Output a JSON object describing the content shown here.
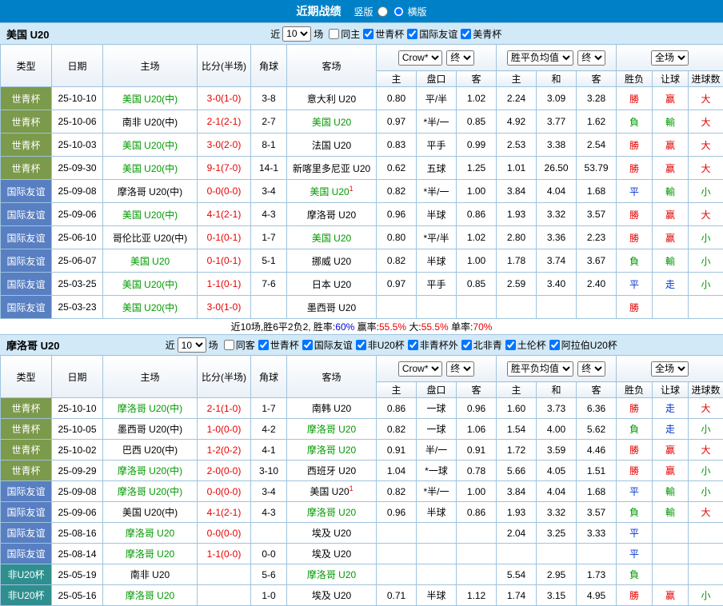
{
  "topbar": {
    "title": "近期战绩",
    "vertical_label": "竖版",
    "horizontal_label": "横版",
    "selected": "横版"
  },
  "colors": {
    "topbar_bg": "#0081C7",
    "section_bg": "#D2E9F7",
    "border": "#9FC3DE",
    "score_red": "#E60000",
    "team_green": "#009900",
    "draw_blue": "#0033CC",
    "league": {
      "世青杯": "#7B9A4B",
      "国际友谊": "#587FC2",
      "非U20杯": "#2E8F8E",
      "美青杯": "#7B9A4B"
    }
  },
  "th": {
    "type": "类型",
    "date": "日期",
    "home": "主场",
    "score": "比分(半场)",
    "corner": "角球",
    "away": "客场",
    "crow": "Crow*",
    "final": "终",
    "avg": "胜平负均值",
    "full": "全场",
    "h": "主",
    "hcp": "盘口",
    "a": "客",
    "h2": "主",
    "d": "和",
    "a2": "客",
    "result": "胜负",
    "handicap": "让球",
    "goals": "进球数"
  },
  "usa": {
    "team": "美国 U20",
    "filter": {
      "prefix": "近",
      "count": "10",
      "suffix": "场",
      "options": [
        {
          "label": "同主",
          "checked": false
        },
        {
          "label": "世青杯",
          "checked": true
        },
        {
          "label": "国际友谊",
          "checked": true
        },
        {
          "label": "美青杯",
          "checked": true
        }
      ]
    },
    "rows": [
      {
        "league": "世青杯",
        "date": "25-10-10",
        "home": "美国 U20(中)",
        "home_self": true,
        "score": "3-0(1-0)",
        "corner": "3-8",
        "away": "意大利 U20",
        "away_self": false,
        "away_sup": "",
        "h": "0.80",
        "hcp": "平/半",
        "a": "1.02",
        "avg_h": "2.24",
        "avg_d": "3.09",
        "avg_a": "3.28",
        "result": "勝",
        "handicap": "赢",
        "goals": "大"
      },
      {
        "league": "世青杯",
        "date": "25-10-06",
        "home": "南非 U20(中)",
        "home_self": false,
        "score": "2-1(2-1)",
        "corner": "2-7",
        "away": "美国 U20",
        "away_self": true,
        "away_sup": "",
        "h": "0.97",
        "hcp": "*半/一",
        "a": "0.85",
        "avg_h": "4.92",
        "avg_d": "3.77",
        "avg_a": "1.62",
        "result": "負",
        "handicap": "輸",
        "goals": "大"
      },
      {
        "league": "世青杯",
        "date": "25-10-03",
        "home": "美国 U20(中)",
        "home_self": true,
        "score": "3-0(2-0)",
        "corner": "8-1",
        "away": "法国 U20",
        "away_self": false,
        "away_sup": "",
        "h": "0.83",
        "hcp": "平手",
        "a": "0.99",
        "avg_h": "2.53",
        "avg_d": "3.38",
        "avg_a": "2.54",
        "result": "勝",
        "handicap": "赢",
        "goals": "大"
      },
      {
        "league": "世青杯",
        "date": "25-09-30",
        "home": "美国 U20(中)",
        "home_self": true,
        "score": "9-1(7-0)",
        "corner": "14-1",
        "away": "新喀里多尼亚 U20",
        "away_self": false,
        "away_sup": "",
        "h": "0.62",
        "hcp": "五球",
        "a": "1.25",
        "avg_h": "1.01",
        "avg_d": "26.50",
        "avg_a": "53.79",
        "result": "勝",
        "handicap": "赢",
        "goals": "大"
      },
      {
        "league": "国际友谊",
        "date": "25-09-08",
        "home": "摩洛哥 U20(中)",
        "home_self": false,
        "score": "0-0(0-0)",
        "corner": "3-4",
        "away": "美国 U20",
        "away_self": true,
        "away_sup": "1",
        "h": "0.82",
        "hcp": "*半/一",
        "a": "1.00",
        "avg_h": "3.84",
        "avg_d": "4.04",
        "avg_a": "1.68",
        "result": "平",
        "handicap": "輸",
        "goals": "小"
      },
      {
        "league": "国际友谊",
        "date": "25-09-06",
        "home": "美国 U20(中)",
        "home_self": true,
        "score": "4-1(2-1)",
        "corner": "4-3",
        "away": "摩洛哥 U20",
        "away_self": false,
        "away_sup": "",
        "h": "0.96",
        "hcp": "半球",
        "a": "0.86",
        "avg_h": "1.93",
        "avg_d": "3.32",
        "avg_a": "3.57",
        "result": "勝",
        "handicap": "赢",
        "goals": "大"
      },
      {
        "league": "国际友谊",
        "date": "25-06-10",
        "home": "哥伦比亚 U20(中)",
        "home_self": false,
        "score": "0-1(0-1)",
        "corner": "1-7",
        "away": "美国 U20",
        "away_self": true,
        "away_sup": "",
        "h": "0.80",
        "hcp": "*平/半",
        "a": "1.02",
        "avg_h": "2.80",
        "avg_d": "3.36",
        "avg_a": "2.23",
        "result": "勝",
        "handicap": "赢",
        "goals": "小"
      },
      {
        "league": "国际友谊",
        "date": "25-06-07",
        "home": "美国 U20",
        "home_self": true,
        "score": "0-1(0-1)",
        "corner": "5-1",
        "away": "挪威 U20",
        "away_self": false,
        "away_sup": "",
        "h": "0.82",
        "hcp": "半球",
        "a": "1.00",
        "avg_h": "1.78",
        "avg_d": "3.74",
        "avg_a": "3.67",
        "result": "負",
        "handicap": "輸",
        "goals": "小"
      },
      {
        "league": "国际友谊",
        "date": "25-03-25",
        "home": "美国 U20(中)",
        "home_self": true,
        "score": "1-1(0-1)",
        "corner": "7-6",
        "away": "日本 U20",
        "away_self": false,
        "away_sup": "",
        "h": "0.97",
        "hcp": "平手",
        "a": "0.85",
        "avg_h": "2.59",
        "avg_d": "3.40",
        "avg_a": "2.40",
        "result": "平",
        "handicap": "走",
        "goals": "小"
      },
      {
        "league": "国际友谊",
        "date": "25-03-23",
        "home": "美国 U20(中)",
        "home_self": true,
        "score": "3-0(1-0)",
        "corner": "",
        "away": "墨西哥 U20",
        "away_self": false,
        "away_sup": "",
        "h": "",
        "hcp": "",
        "a": "",
        "avg_h": "",
        "avg_d": "",
        "avg_a": "",
        "result": "勝",
        "handicap": "",
        "goals": ""
      }
    ],
    "summary": {
      "parts": [
        {
          "text": "近10场,胜6平2负2, 胜率:",
          "color": "#000000"
        },
        {
          "text": "60%",
          "color": "#0000E0"
        },
        {
          "text": " 赢率:",
          "color": "#000000"
        },
        {
          "text": "55.5%",
          "color": "#E60000"
        },
        {
          "text": " 大:",
          "color": "#000000"
        },
        {
          "text": "55.5%",
          "color": "#E60000"
        },
        {
          "text": " 单率:",
          "color": "#000000"
        },
        {
          "text": "70%",
          "color": "#E60000"
        }
      ]
    }
  },
  "morocco": {
    "team": "摩洛哥 U20",
    "filter": {
      "prefix": "近",
      "count": "10",
      "suffix": "场",
      "options": [
        {
          "label": "同客",
          "checked": false
        },
        {
          "label": "世青杯",
          "checked": true
        },
        {
          "label": "国际友谊",
          "checked": true
        },
        {
          "label": "非U20杯",
          "checked": true
        },
        {
          "label": "非青杯外",
          "checked": true
        },
        {
          "label": "北非青",
          "checked": true
        },
        {
          "label": "土伦杯",
          "checked": true
        },
        {
          "label": "阿拉伯U20杯",
          "checked": true
        }
      ]
    },
    "rows": [
      {
        "league": "世青杯",
        "date": "25-10-10",
        "home": "摩洛哥 U20(中)",
        "home_self": true,
        "score": "2-1(1-0)",
        "corner": "1-7",
        "away": "南韩 U20",
        "away_self": false,
        "away_sup": "",
        "h": "0.86",
        "hcp": "一球",
        "a": "0.96",
        "avg_h": "1.60",
        "avg_d": "3.73",
        "avg_a": "6.36",
        "result": "勝",
        "handicap": "走",
        "goals": "大"
      },
      {
        "league": "世青杯",
        "date": "25-10-05",
        "home": "墨西哥 U20(中)",
        "home_self": false,
        "score": "1-0(0-0)",
        "corner": "4-2",
        "away": "摩洛哥 U20",
        "away_self": true,
        "away_sup": "",
        "h": "0.82",
        "hcp": "一球",
        "a": "1.06",
        "avg_h": "1.54",
        "avg_d": "4.00",
        "avg_a": "5.62",
        "result": "負",
        "handicap": "走",
        "goals": "小"
      },
      {
        "league": "世青杯",
        "date": "25-10-02",
        "home": "巴西 U20(中)",
        "home_self": false,
        "score": "1-2(0-2)",
        "corner": "4-1",
        "away": "摩洛哥 U20",
        "away_self": true,
        "away_sup": "",
        "h": "0.91",
        "hcp": "半/一",
        "a": "0.91",
        "avg_h": "1.72",
        "avg_d": "3.59",
        "avg_a": "4.46",
        "result": "勝",
        "handicap": "赢",
        "goals": "大"
      },
      {
        "league": "世青杯",
        "date": "25-09-29",
        "home": "摩洛哥 U20(中)",
        "home_self": true,
        "score": "2-0(0-0)",
        "corner": "3-10",
        "away": "西班牙 U20",
        "away_self": false,
        "away_sup": "",
        "h": "1.04",
        "hcp": "*一球",
        "a": "0.78",
        "avg_h": "5.66",
        "avg_d": "4.05",
        "avg_a": "1.51",
        "result": "勝",
        "handicap": "赢",
        "goals": "小"
      },
      {
        "league": "国际友谊",
        "date": "25-09-08",
        "home": "摩洛哥 U20(中)",
        "home_self": true,
        "score": "0-0(0-0)",
        "corner": "3-4",
        "away": "美国 U20",
        "away_self": false,
        "away_sup": "1",
        "h": "0.82",
        "hcp": "*半/一",
        "a": "1.00",
        "avg_h": "3.84",
        "avg_d": "4.04",
        "avg_a": "1.68",
        "result": "平",
        "handicap": "輸",
        "goals": "小"
      },
      {
        "league": "国际友谊",
        "date": "25-09-06",
        "home": "美国 U20(中)",
        "home_self": false,
        "score": "4-1(2-1)",
        "corner": "4-3",
        "away": "摩洛哥 U20",
        "away_self": true,
        "away_sup": "",
        "h": "0.96",
        "hcp": "半球",
        "a": "0.86",
        "avg_h": "1.93",
        "avg_d": "3.32",
        "avg_a": "3.57",
        "result": "負",
        "handicap": "輸",
        "goals": "大"
      },
      {
        "league": "国际友谊",
        "date": "25-08-16",
        "home": "摩洛哥 U20",
        "home_self": true,
        "score": "0-0(0-0)",
        "corner": "",
        "away": "埃及 U20",
        "away_self": false,
        "away_sup": "",
        "h": "",
        "hcp": "",
        "a": "",
        "avg_h": "2.04",
        "avg_d": "3.25",
        "avg_a": "3.33",
        "result": "平",
        "handicap": "",
        "goals": ""
      },
      {
        "league": "国际友谊",
        "date": "25-08-14",
        "home": "摩洛哥 U20",
        "home_self": true,
        "score": "1-1(0-0)",
        "corner": "0-0",
        "away": "埃及 U20",
        "away_self": false,
        "away_sup": "",
        "h": "",
        "hcp": "",
        "a": "",
        "avg_h": "",
        "avg_d": "",
        "avg_a": "",
        "result": "平",
        "handicap": "",
        "goals": ""
      },
      {
        "league": "非U20杯",
        "date": "25-05-19",
        "home": "南非 U20",
        "home_self": false,
        "score": "",
        "corner": "5-6",
        "away": "摩洛哥 U20",
        "away_self": true,
        "away_sup": "",
        "h": "",
        "hcp": "",
        "a": "",
        "avg_h": "5.54",
        "avg_d": "2.95",
        "avg_a": "1.73",
        "result": "負",
        "handicap": "",
        "goals": ""
      },
      {
        "league": "非U20杯",
        "date": "25-05-16",
        "home": "摩洛哥 U20",
        "home_self": true,
        "score": "",
        "corner": "1-0",
        "away": "埃及 U20",
        "away_self": false,
        "away_sup": "",
        "h": "0.71",
        "hcp": "半球",
        "a": "1.12",
        "avg_h": "1.74",
        "avg_d": "3.15",
        "avg_a": "4.95",
        "result": "勝",
        "handicap": "赢",
        "goals": "小"
      }
    ]
  }
}
